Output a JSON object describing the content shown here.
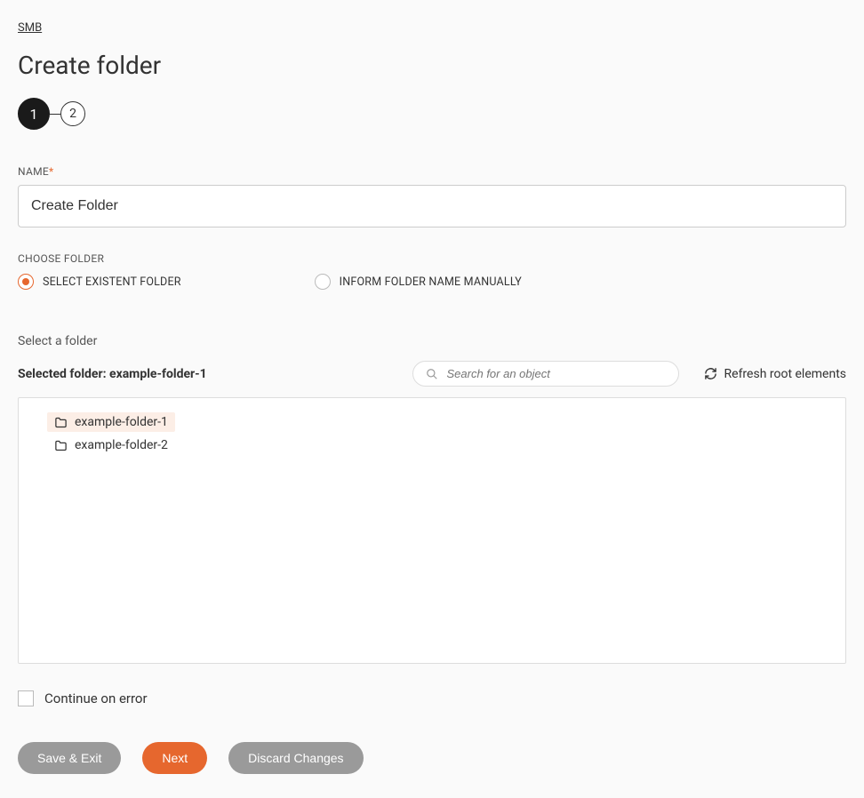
{
  "breadcrumb": "SMB",
  "page_title": "Create folder",
  "stepper": {
    "step1": "1",
    "step2": "2"
  },
  "name_field": {
    "label": "NAME",
    "value": "Create Folder"
  },
  "choose_folder": {
    "label": "CHOOSE FOLDER",
    "option_select": "SELECT EXISTENT FOLDER",
    "option_manual": "INFORM FOLDER NAME MANUALLY"
  },
  "folder_picker": {
    "heading": "Select a folder",
    "selected_text": "Selected folder: example-folder-1",
    "search_placeholder": "Search for an object",
    "refresh_label": "Refresh root elements",
    "items": [
      {
        "label": "example-folder-1",
        "selected": true
      },
      {
        "label": "example-folder-2",
        "selected": false
      }
    ]
  },
  "continue_on_error_label": "Continue on error",
  "buttons": {
    "save_exit": "Save & Exit",
    "next": "Next",
    "discard": "Discard Changes"
  }
}
